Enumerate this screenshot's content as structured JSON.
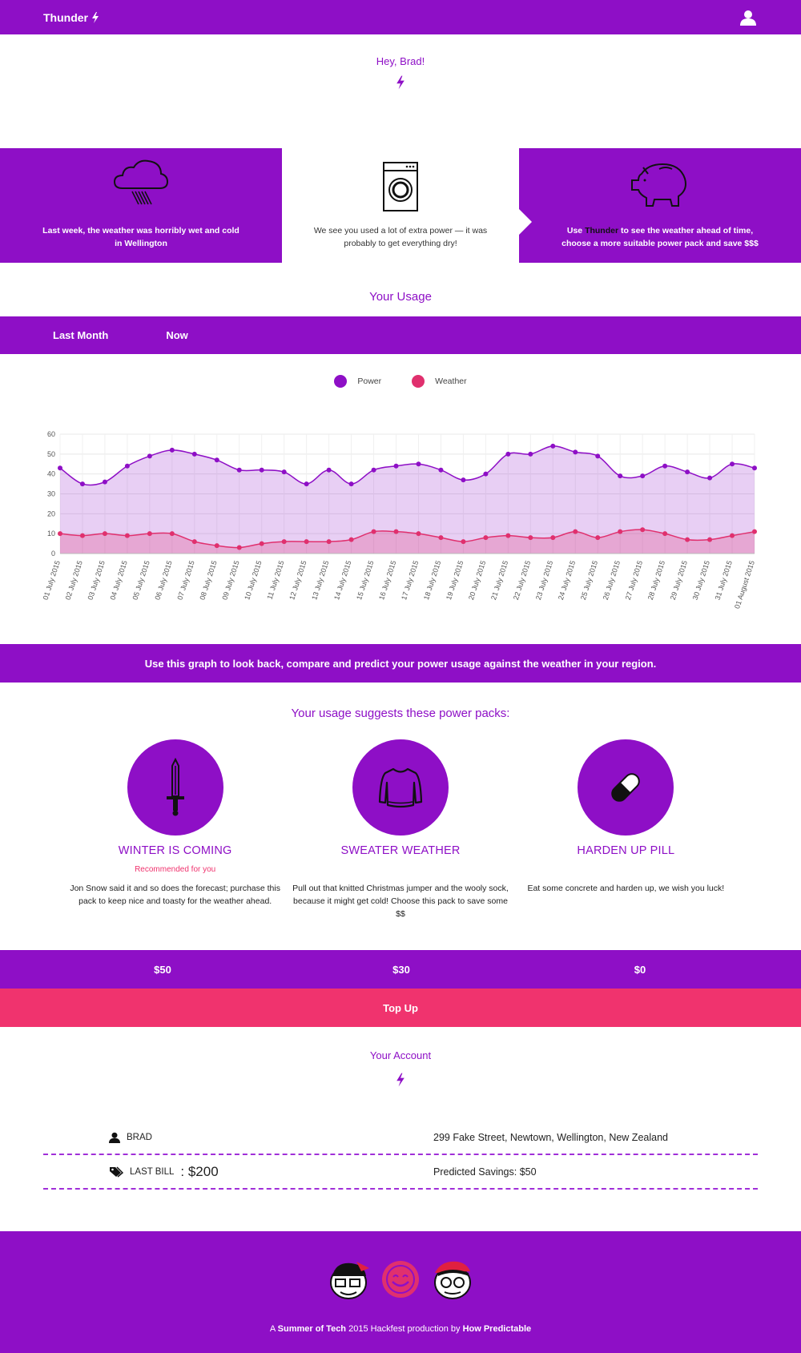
{
  "header": {
    "brand": "Thunder",
    "bolt_icon": "bolt-icon",
    "user_icon": "user-icon"
  },
  "greeting": {
    "text": "Hey, Brad!"
  },
  "tiles": [
    {
      "icon": "rain-cloud-icon",
      "text": "Last week, the weather was horribly wet and cold in Wellington"
    },
    {
      "icon": "washing-machine-icon",
      "text": "We see you used a lot of extra power — it was probably to get everything dry!"
    },
    {
      "icon": "piggy-bank-icon",
      "text_prefix": "Use ",
      "text_bold": "Thunder",
      "text_suffix": " to see the weather ahead of time, choose a more suitable power pack and save $$$"
    }
  ],
  "usage": {
    "title": "Your Usage",
    "tabs": [
      "Last Month",
      "Now"
    ],
    "legend": [
      "Power",
      "Weather"
    ],
    "banner": "Use this graph to look back, compare and predict your power usage against the weather in your region."
  },
  "colors": {
    "brand": "#8e0fc6",
    "accent": "#f0336e",
    "power": "#8e0fc6",
    "weather": "#e0306e"
  },
  "chart_data": {
    "type": "area",
    "ylim": [
      0,
      60
    ],
    "yticks": [
      0,
      10,
      20,
      30,
      40,
      50,
      60
    ],
    "categories": [
      "01 July 2015",
      "02 July 2015",
      "03 July 2015",
      "04 July 2015",
      "05 July 2015",
      "06 July 2015",
      "07 July 2015",
      "08 July 2015",
      "09 July 2015",
      "10 July 2015",
      "11 July 2015",
      "12 July 2015",
      "13 July 2015",
      "14 July 2015",
      "15 July 2015",
      "16 July 2015",
      "17 July 2015",
      "18 July 2015",
      "19 July 2015",
      "20 July 2015",
      "21 July 2015",
      "22 July 2015",
      "23 July 2015",
      "24 July 2015",
      "25 July 2015",
      "26 July 2015",
      "27 July 2015",
      "28 July 2015",
      "29 July 2015",
      "30 July 2015",
      "31 July 2015",
      "01 August 2015"
    ],
    "series": [
      {
        "name": "Power",
        "values": [
          43,
          35,
          36,
          44,
          49,
          52,
          50,
          47,
          42,
          42,
          41,
          35,
          42,
          35,
          42,
          44,
          45,
          42,
          37,
          40,
          50,
          50,
          54,
          51,
          49,
          39,
          39,
          44,
          41,
          38,
          45,
          43
        ]
      },
      {
        "name": "Weather",
        "values": [
          10,
          9,
          10,
          9,
          10,
          10,
          6,
          4,
          3,
          5,
          6,
          6,
          6,
          7,
          11,
          11,
          10,
          8,
          6,
          8,
          9,
          8,
          8,
          11,
          8,
          11,
          12,
          10,
          7,
          7,
          9,
          11
        ]
      }
    ],
    "grid": true
  },
  "packs": {
    "title": "Your usage suggests these power packs:",
    "items": [
      {
        "icon": "sword-icon",
        "name": "WINTER IS COMING",
        "recommended": "Recommended for you",
        "desc": "Jon Snow said it and so does the forecast; purchase this pack to keep nice and toasty for the weather ahead.",
        "price": "$50"
      },
      {
        "icon": "sweater-icon",
        "name": "SWEATER WEATHER",
        "recommended": "",
        "desc": "Pull out that knitted Christmas jumper and the wooly sock, because it might get cold! Choose this pack to save some $$",
        "price": "$30"
      },
      {
        "icon": "pill-icon",
        "name": "HARDEN UP PILL",
        "recommended": "",
        "desc": "Eat some concrete and harden up, we wish you luck!",
        "price": "$0"
      }
    ],
    "topup": "Top Up"
  },
  "account": {
    "title": "Your Account",
    "name": "BRAD",
    "address": "299 Fake Street, Newtown, Wellington, New Zealand",
    "last_bill_label": "LAST BILL",
    "last_bill_value": ": $200",
    "savings": "Predicted Savings: $50"
  },
  "footer": {
    "prefix": "A ",
    "summer": "Summer of Tech",
    "middle": " 2015 Hackfest production by ",
    "company": "How Predictable"
  }
}
